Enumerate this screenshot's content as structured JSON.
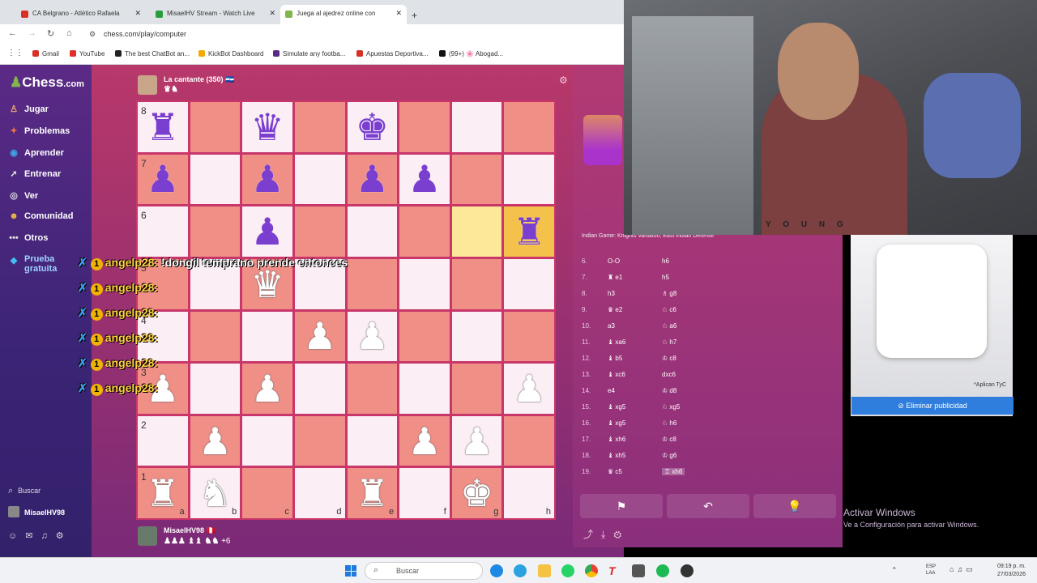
{
  "tabs": [
    {
      "label": "CA Belgrano - Atlético Rafaela",
      "color": "#d93025"
    },
    {
      "label": "MisaelHV Stream - Watch Live",
      "color": "#2a9d3f"
    },
    {
      "label": "Juega al ajedrez online con",
      "color": "#81b64c"
    }
  ],
  "url": "chess.com/play/computer",
  "bookmarks": [
    {
      "label": "Gmail",
      "color": "#d93025"
    },
    {
      "label": "YouTube",
      "color": "#e52d27"
    },
    {
      "label": "The best ChatBot an...",
      "color": "#222"
    },
    {
      "label": "KickBot Dashboard",
      "color": "#f6a700"
    },
    {
      "label": "Simulate any footba...",
      "color": "#5b2a86"
    },
    {
      "label": "Apuestas Deportiva...",
      "color": "#d93025"
    },
    {
      "label": "(99+) 🌸 Abogad...",
      "color": "#111"
    }
  ],
  "logo": {
    "pre": "",
    "main": "Chess",
    "suffix": ".com"
  },
  "nav": [
    {
      "label": "Jugar",
      "icon": "♙"
    },
    {
      "label": "Problemas",
      "icon": "✦"
    },
    {
      "label": "Aprender",
      "icon": "◉"
    },
    {
      "label": "Entrenar",
      "icon": "➚"
    },
    {
      "label": "Ver",
      "icon": "◎"
    },
    {
      "label": "Comunidad",
      "icon": "☻"
    },
    {
      "label": "Otros",
      "icon": "•••"
    },
    {
      "label": "Prueba gratuita",
      "icon": "◆"
    }
  ],
  "sidebar_bottom": {
    "search": "Buscar",
    "user": "MisaelHV98"
  },
  "top_player": {
    "name": "La cantante (350)",
    "flag": "🇸🇻",
    "icons": "♛♞"
  },
  "bottom_player": {
    "name": "MisaelHV98",
    "flag": "🇵🇪",
    "icons": "♟♟♟ ♝♝ ♞♞",
    "extra": "+6"
  },
  "chat": [
    {
      "user": "angelp28:",
      "msg": " !dongil temprano prende entonces"
    },
    {
      "user": "angelp28:",
      "msg": ""
    },
    {
      "user": "angelp28:",
      "msg": ""
    },
    {
      "user": "angelp28:",
      "msg": ""
    },
    {
      "user": "angelp28:",
      "msg": ""
    },
    {
      "user": "angelp28:",
      "msg": ""
    }
  ],
  "opening": "Indian Game: Knights Variation, East Indian Defense",
  "moves": [
    {
      "n": "6.",
      "w": "O-O",
      "b": "h6"
    },
    {
      "n": "7.",
      "w": "♜ e1",
      "b": "h5"
    },
    {
      "n": "8.",
      "w": "h3",
      "b": "♗ g8"
    },
    {
      "n": "9.",
      "w": "♛ e2",
      "b": "♘ c6"
    },
    {
      "n": "10.",
      "w": "a3",
      "b": "♘ a6"
    },
    {
      "n": "11.",
      "w": "♝ xa6",
      "b": "♘ h7"
    },
    {
      "n": "12.",
      "w": "♝ b5",
      "b": "♔ c8"
    },
    {
      "n": "13.",
      "w": "♝ xc6",
      "b": "dxc6"
    },
    {
      "n": "14.",
      "w": "e4",
      "b": "♔ d8"
    },
    {
      "n": "15.",
      "w": "♝ xg5",
      "b": "♘ xg5"
    },
    {
      "n": "16.",
      "w": "♝ xg5",
      "b": "♘ h6"
    },
    {
      "n": "17.",
      "w": "♝ xh6",
      "b": "♔ c8"
    },
    {
      "n": "18.",
      "w": "♝ xh5",
      "b": "♔ g6"
    },
    {
      "n": "19.",
      "w": "♛ c5",
      "b": "♖ xh6"
    }
  ],
  "buttons": {
    "resign": "⚑",
    "undo": "↶",
    "hint": "💡"
  },
  "ad": {
    "note": "*Aplican TyC",
    "cta": "Eliminar publicidad"
  },
  "activate": {
    "title": "Activar Windows",
    "sub": "Ve a Configuración para activar Windows."
  },
  "taskbar": {
    "search": "Buscar",
    "lang": "ESP\nLAA",
    "time": "09:19 p. m.",
    "date": "27/03/2026"
  },
  "webcam_text": "Y O U N G"
}
